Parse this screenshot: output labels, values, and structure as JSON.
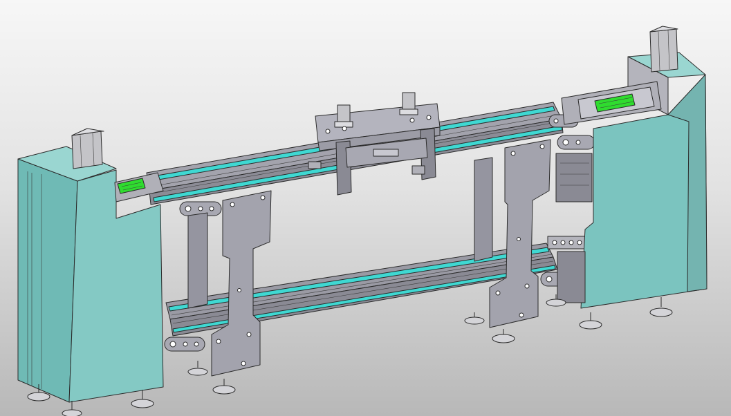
{
  "scene": {
    "colors": {
      "background_top": "#f7f7f7",
      "background_bottom": "#b8b8b8",
      "housing": "#74bdb8",
      "housing_side": "#8fd0cb",
      "frame": "#a3a3ad",
      "frame_dark": "#7c7c86",
      "belt": "#3fd8d2",
      "pcb": "#2fdc2f",
      "motor": "#c4c4c8",
      "edge": "#2a2a2a"
    },
    "parts": [
      "left-housing",
      "right-housing",
      "upper-conveyor",
      "lower-conveyor",
      "left-support-plate",
      "right-support-plate",
      "top-gantry",
      "leveling-feet"
    ]
  }
}
